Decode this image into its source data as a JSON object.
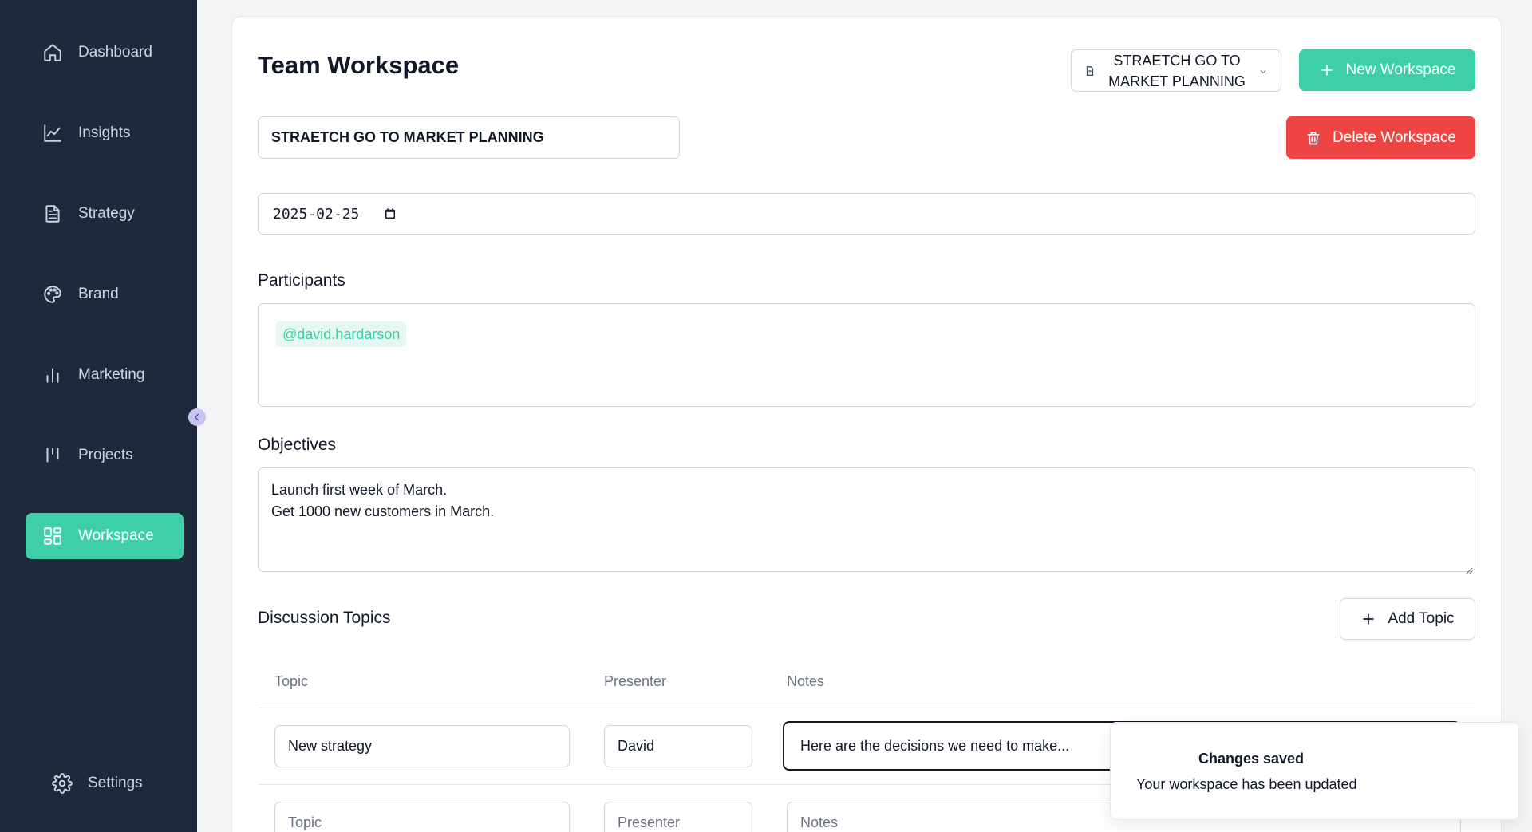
{
  "sidebar": {
    "items": [
      {
        "label": "Dashboard",
        "icon": "home-icon"
      },
      {
        "label": "Insights",
        "icon": "line-chart-icon"
      },
      {
        "label": "Strategy",
        "icon": "document-icon"
      },
      {
        "label": "Brand",
        "icon": "palette-icon"
      },
      {
        "label": "Marketing",
        "icon": "bar-chart-icon"
      },
      {
        "label": "Projects",
        "icon": "kanban-icon"
      },
      {
        "label": "Workspace",
        "icon": "grid-icon",
        "active": true
      }
    ],
    "settings_label": "Settings"
  },
  "header": {
    "title": "Team Workspace",
    "workspace_select": "STRAETCH GO TO MARKET PLANNING",
    "new_workspace_label": "New Workspace",
    "delete_workspace_label": "Delete Workspace"
  },
  "form": {
    "workspace_name": "STRAETCH GO TO MARKET PLANNING",
    "date": "2025-02-25",
    "participants_label": "Participants",
    "participants": [
      "@david.hardarson"
    ],
    "objectives_label": "Objectives",
    "objectives_lines": [
      "Launch first week of March.",
      "Get 1000 new customers in March."
    ]
  },
  "topics": {
    "section_label": "Discussion Topics",
    "add_topic_label": "Add Topic",
    "columns": [
      "Topic",
      "Presenter",
      "Notes"
    ],
    "rows": [
      {
        "topic": "New strategy",
        "presenter": "David",
        "notes": "Here are the decisions we need to make..."
      }
    ],
    "new_row_placeholders": {
      "topic": "Topic",
      "presenter": "Presenter",
      "notes": "Notes"
    }
  },
  "toast": {
    "title": "Changes saved",
    "description": "Your workspace has been updated"
  },
  "colors": {
    "sidebar_bg": "#1e293b",
    "accent": "#3ecfa8",
    "danger": "#ef4444"
  }
}
